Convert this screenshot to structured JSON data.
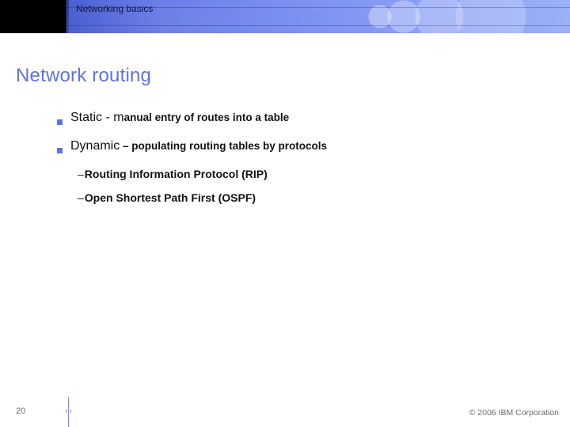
{
  "header": {
    "label": "Networking basics"
  },
  "title": "Network routing",
  "bullets": [
    {
      "lead": "Static - m",
      "rest": "anual entry of routes into a table",
      "sub": []
    },
    {
      "lead": "Dynamic",
      "rest": " – populating routing tables by protocols",
      "sub": [
        "Routing Information Protocol (RIP)",
        "Open Shortest Path First (OSPF)"
      ]
    }
  ],
  "footer": {
    "page": "20",
    "copyright": "© 2006 IBM Corporation"
  }
}
